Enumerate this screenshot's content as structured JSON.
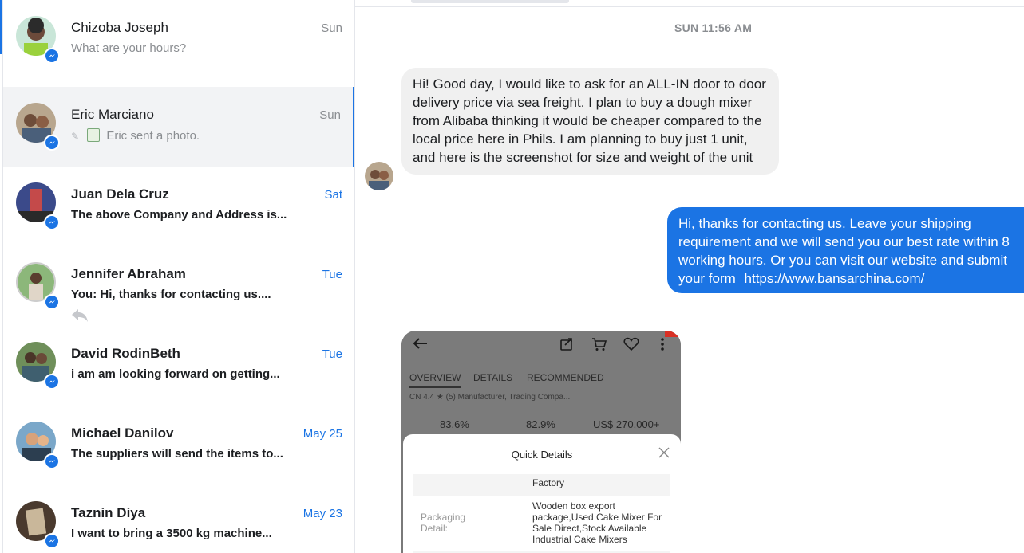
{
  "conversations": [
    {
      "name": "Chizoba Joseph",
      "time": "Sun",
      "preview": "What are your hours?",
      "unread": false,
      "selected": false
    },
    {
      "name": "Eric Marciano",
      "time": "Sun",
      "preview": "Eric sent a photo.",
      "unread": false,
      "selected": true
    },
    {
      "name": "Juan Dela Cruz",
      "time": "Sat",
      "preview": "The above Company and Address is...",
      "unread": true,
      "selected": false
    },
    {
      "name": "Jennifer Abraham",
      "time": "Tue",
      "preview": "You: Hi, thanks for contacting us....",
      "unread": true,
      "selected": false
    },
    {
      "name": "David RodinBeth",
      "time": "Tue",
      "preview": "i am am looking forward on getting...",
      "unread": true,
      "selected": false
    },
    {
      "name": "Michael Danilov",
      "time": "May 25",
      "preview": "The suppliers will send the items to...",
      "unread": true,
      "selected": false
    },
    {
      "name": "Taznin Diya",
      "time": "May 23",
      "preview": "I want to bring a 3500 kg machine...",
      "unread": true,
      "selected": false
    }
  ],
  "chat": {
    "timestamp": "SUN 11:56 AM",
    "incoming_message": "Hi! Good day, I would like to ask for an ALL-IN door to door delivery price via sea freight. I plan to buy a dough mixer from Alibaba thinking it would be cheaper compared to the local price here in Phils. I am planning to buy just 1 unit, and here is the screenshot for size and weight of the unit",
    "outgoing_message": "Hi, thanks for contacting us. Leave your shipping requirement and we will send you our best rate within 8 working hours. Or you can visit our website and submit your form",
    "outgoing_link": "https://www.bansarchina.com/",
    "photo": {
      "tabs": [
        "OVERVIEW",
        "DETAILS",
        "RECOMMENDED"
      ],
      "faded_line": "CN   4.4 ★ (5)     Manufacturer, Trading Compa...",
      "stats": [
        "83.6%",
        "82.9%",
        "US$ 270,000+"
      ],
      "sheet_title": "Quick Details",
      "row1_value": "Factory",
      "row2_label": "Packaging Detail:",
      "row2_value": "Wooden box export package,Used Cake Mixer For Sale Direct,Stock Available Industrial Cake Mixers"
    }
  },
  "colors": {
    "accent": "#1b74e4",
    "incoming_bubble": "#f0f0f0",
    "muted_text": "#8a8d91"
  }
}
